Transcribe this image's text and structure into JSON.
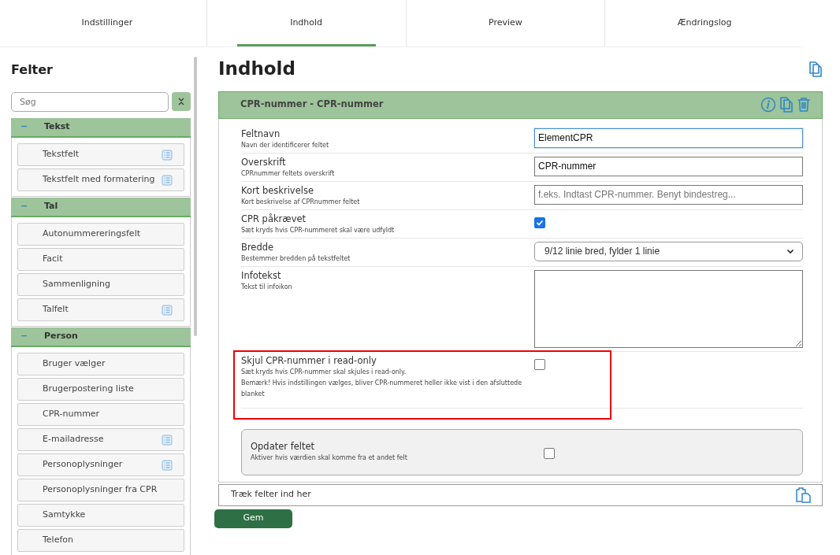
{
  "tabs": [
    {
      "label": "Indstillinger",
      "selected": false
    },
    {
      "label": "Indhold",
      "selected": true
    },
    {
      "label": "Preview",
      "selected": false
    },
    {
      "label": "Ændringslog",
      "selected": false
    }
  ],
  "sidebar": {
    "title": "Felter",
    "search": {
      "placeholder": "Søg"
    },
    "groups": [
      {
        "title": "Tekst",
        "toggle": "−",
        "expanded": true,
        "items": [
          {
            "label": "Tekstfelt",
            "icon": true
          },
          {
            "label": "Tekstfelt med formatering",
            "icon": true
          }
        ]
      },
      {
        "title": "Tal",
        "toggle": "−",
        "expanded": true,
        "items": [
          {
            "label": "Autonummereringsfelt",
            "icon": false
          },
          {
            "label": "Facit",
            "icon": false
          },
          {
            "label": "Sammenligning",
            "icon": false
          },
          {
            "label": "Talfelt",
            "icon": true
          }
        ]
      },
      {
        "title": "Person",
        "toggle": "−",
        "expanded": true,
        "items": [
          {
            "label": "Bruger vælger",
            "icon": false
          },
          {
            "label": "Brugerpostering liste",
            "icon": false
          },
          {
            "label": "CPR-nummer",
            "icon": false
          },
          {
            "label": "E-mailadresse",
            "icon": true
          },
          {
            "label": "Personoplysninger",
            "icon": true
          },
          {
            "label": "Personoplysninger fra CPR",
            "icon": false
          },
          {
            "label": "Samtykke",
            "icon": false
          },
          {
            "label": "Telefon",
            "icon": false
          }
        ]
      }
    ]
  },
  "main": {
    "title": "Indhold",
    "element": {
      "title": "CPR-nummer - CPR-nummer",
      "rows": [
        {
          "kind": "text",
          "label": "Feltnavn",
          "help": "Navn der identificerer feltet",
          "value": "ElementCPR",
          "focused": true
        },
        {
          "kind": "text",
          "label": "Overskrift",
          "help": "CPRnummer feltets overskrift",
          "value": "CPR-nummer",
          "focused": false
        },
        {
          "kind": "text",
          "label": "Kort beskrivelse",
          "help": "Kort beskrivelse af CPRnummer feltet",
          "placeholder": "f.eks. Indtast CPR-nummer. Benyt bindestreg...",
          "focused": false
        },
        {
          "kind": "checkbox",
          "label": "CPR påkrævet",
          "help": "Sæt kryds hvis CPR-nummeret skal være udfyldt",
          "checked": true,
          "highlighted": false
        },
        {
          "kind": "select",
          "label": "Bredde",
          "help": "Bestemmer bredden på tekstfeltet",
          "value": "9/12 linie bred, fylder 1 linie"
        },
        {
          "kind": "textarea",
          "label": "Infotekst",
          "help": "Tekst til infoikon"
        },
        {
          "kind": "checkbox",
          "label": "Skjul CPR-nummer i read-only",
          "help": "Sæt kryds hvis CPR-nummer skal skjules i read-only.",
          "note": "Bemærk! Hvis indstillingen vælges, bliver CPR-nummeret heller ikke vist i den afsluttede blanket",
          "checked": false,
          "highlighted": true
        }
      ],
      "update": {
        "label": "Opdater feltet",
        "help": "Aktiver hvis værdien skal komme fra et andet felt",
        "checked": false
      }
    },
    "dropzone": "Træk felter ind her",
    "save": "Gem"
  }
}
